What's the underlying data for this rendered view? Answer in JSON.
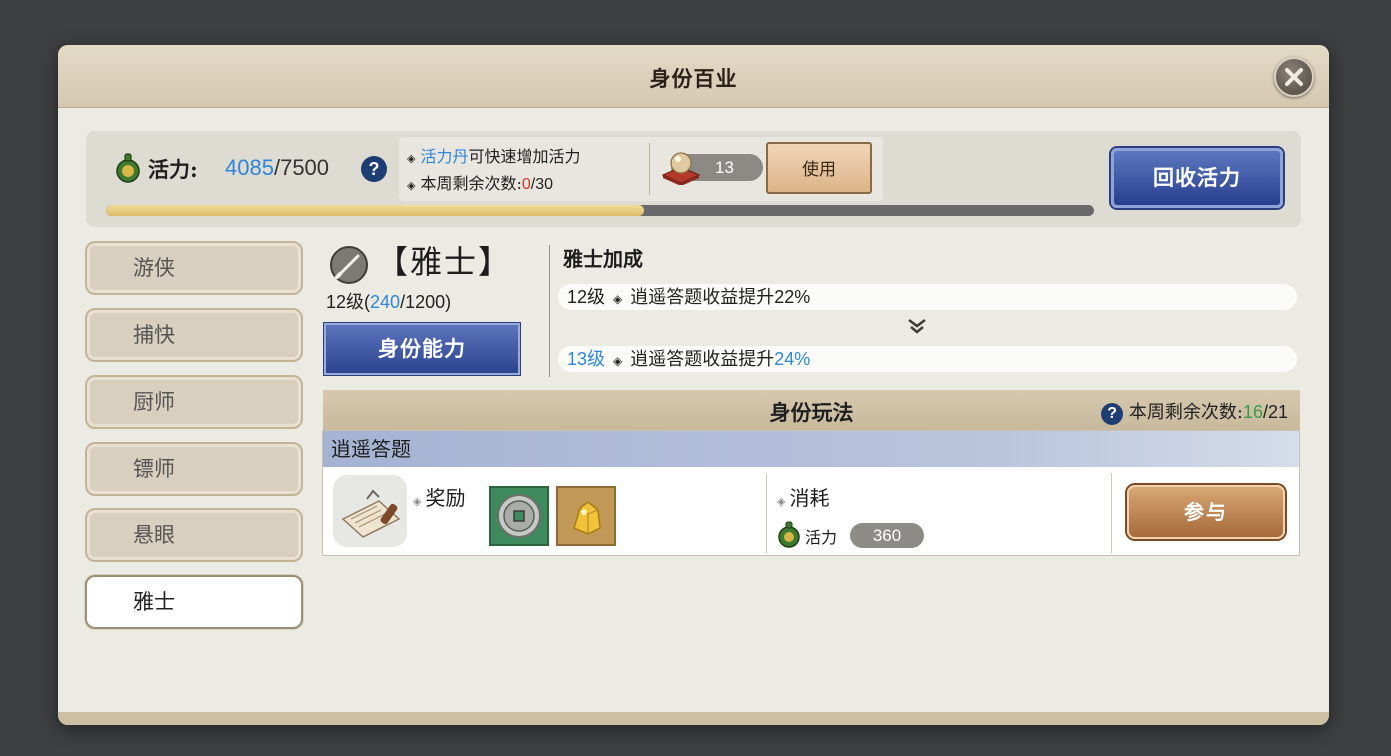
{
  "window": {
    "title": "身份百业"
  },
  "vitality": {
    "label": "活力:",
    "current": "4085",
    "separator": "/",
    "max": "7500",
    "progress_fraction": 0.545,
    "help_symbol": "?"
  },
  "info": {
    "line1_item": "活力丹",
    "line1_text": "可快速增加活力",
    "line2_text": "本周剩余次数:",
    "line2_used": "0",
    "line2_total": "/30",
    "item_count": "13",
    "use_label": "使用"
  },
  "recycle_label": "回收活力",
  "sidebar": {
    "tabs": [
      {
        "label": "游侠"
      },
      {
        "label": "捕快"
      },
      {
        "label": "厨师"
      },
      {
        "label": "镖师"
      },
      {
        "label": "悬眼"
      },
      {
        "label": "雅士"
      }
    ],
    "active_index": 5
  },
  "identity": {
    "name": "【雅士】",
    "level_prefix": "12级(",
    "exp_current": "240",
    "exp_rest": "/1200)",
    "ability_label": "身份能力"
  },
  "bonus": {
    "title": "雅士加成",
    "current": {
      "level": "12级",
      "text": "逍遥答题收益提升",
      "pct": "22%"
    },
    "next": {
      "level": "13级",
      "text": "逍遥答题收益提升",
      "pct": "24%"
    }
  },
  "play": {
    "title": "身份玩法",
    "weekly_label": "本周剩余次数:",
    "weekly_remaining": "16",
    "weekly_total": "/21",
    "activity": {
      "name": "逍遥答题",
      "reward_label": "奖励",
      "cost_label": "消耗",
      "cost_name": "活力",
      "cost_value": "360",
      "join_label": "参与"
    }
  },
  "colors": {
    "accent_blue": "#2f87d6",
    "alert_red": "#d2382e",
    "ok_green": "#3b9b4a",
    "progress_gold": "#e6c87a"
  }
}
